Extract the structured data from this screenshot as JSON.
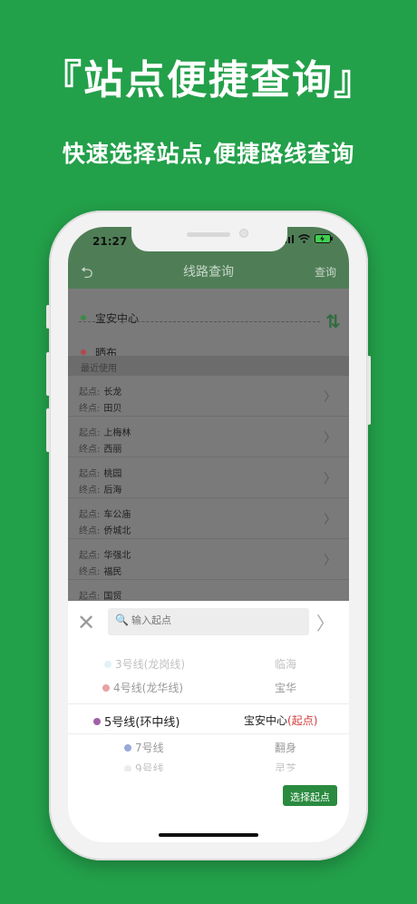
{
  "promo": {
    "headline": "『站点便捷查询』",
    "subline": "快速选择站点,便捷路线查询"
  },
  "status_bar": {
    "time": "21:27"
  },
  "nav": {
    "back_glyph": "⮌",
    "title": "线路查询",
    "query_label": "查询"
  },
  "route": {
    "start": {
      "name": "宝安中心",
      "dot_color": "#3e8a4a"
    },
    "end": {
      "name": "晒布",
      "dot_color": "#b3474f"
    },
    "swap_glyph": "⇅"
  },
  "recent": {
    "header": "最近使用",
    "start_label": "起点:",
    "end_label": "终点:",
    "items": [
      {
        "start": "长龙",
        "end": "田贝"
      },
      {
        "start": "上梅林",
        "end": "西丽"
      },
      {
        "start": "桃园",
        "end": "后海"
      },
      {
        "start": "车公庙",
        "end": "侨城北"
      },
      {
        "start": "华强北",
        "end": "福民"
      },
      {
        "start": "国贸",
        "end": ""
      }
    ]
  },
  "picker": {
    "search_placeholder": "输入起点",
    "lines": [
      {
        "label": "3号线(龙岗线)",
        "color": "#8ec9e8"
      },
      {
        "label": "4号线(龙华线)",
        "color": "#e8a2a2"
      },
      {
        "label": "5号线(环中线)",
        "color": "#a060a8"
      },
      {
        "label": "7号线",
        "color": "#9aa8d8"
      },
      {
        "label": "9号线",
        "color": "#b8b8b8"
      }
    ],
    "stations": [
      "临海",
      "宝华",
      "宝安中心",
      "翻身",
      "灵芝"
    ],
    "selected_suffix": "(起点)",
    "confirm_label": "选择起点"
  },
  "colors": {
    "background": "#23a04a",
    "nav_bar": "#4f7e56",
    "confirm_button": "#2a8a3f",
    "selected_suffix": "#d23a3a"
  }
}
